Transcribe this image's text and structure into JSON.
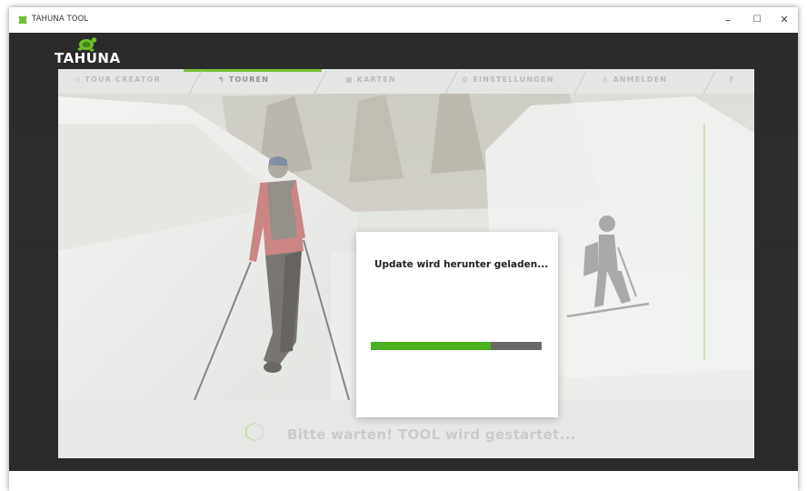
{
  "window": {
    "title": "TAHUNA TOOL",
    "minimize_label": "–",
    "maximize_label": "☐",
    "close_label": "✕"
  },
  "logo": {
    "text": "TAHUNA",
    "icon": "turtle-logo-icon"
  },
  "nav": {
    "items": [
      {
        "label": "TOUR CREATOR",
        "icon": "diamond-icon",
        "active": false
      },
      {
        "label": "TOUREN",
        "icon": "route-icon",
        "active": true
      },
      {
        "label": "KARTEN",
        "icon": "map-icon",
        "active": false
      },
      {
        "label": "EINSTELLUNGEN",
        "icon": "gear-icon",
        "active": false
      },
      {
        "label": "ANMELDEN",
        "icon": "user-icon",
        "active": false
      },
      {
        "label": "?",
        "icon": "help-icon",
        "active": false
      }
    ]
  },
  "dialog": {
    "title": "Update wird herunter geladen...",
    "progress": 0.7
  },
  "status": {
    "text": "Bitte warten! TOOL wird gestartet..."
  },
  "colors": {
    "accent": "#7bbf3a",
    "progress_fill": "#4caf1f",
    "progress_track": "#6a6a6a",
    "app_background": "#2b2b2b"
  }
}
